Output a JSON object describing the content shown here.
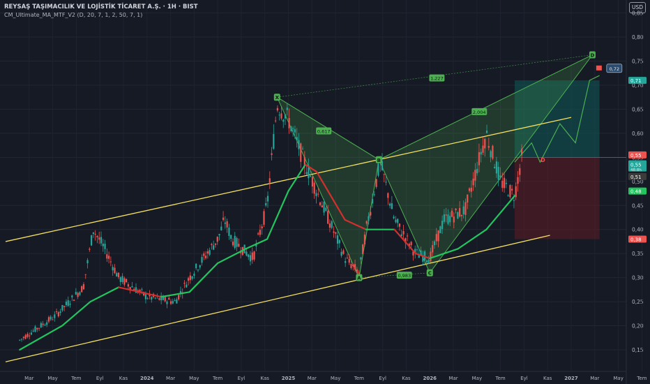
{
  "header": {
    "title": "REYSAŞ TAŞIMACILIK VE LOJİSTİK TİCARET A.Ş. · 1H · BIST",
    "indicator": "CM_Ultimate_MA_MTF_V2 (D, 20, 7, 1, 2, 50, 7, 1)"
  },
  "currency_button": "USD",
  "colors": {
    "background": "#161a25",
    "up": "#26a69a",
    "down": "#ef5350",
    "ma_up": "#22c55e",
    "ma_down": "#d32f2f",
    "channel": "#f6e05e",
    "pattern": "#4caf50",
    "target": "#26a69a",
    "stop": "#ef5350"
  },
  "chart_data": {
    "type": "candlestick",
    "ylim": [
      0.105,
      0.877
    ],
    "yticks": [
      "0,15",
      "0,20",
      "0,25",
      "0,30",
      "0,35",
      "0,40",
      "0,45",
      "0,50",
      "0,55",
      "0,60",
      "0,65",
      "0,70",
      "0,75",
      "0,80",
      "0,85"
    ],
    "xticks": [
      "Mar",
      "May",
      "Tem",
      "Eyl",
      "Kas",
      "2024",
      "Mar",
      "May",
      "Tem",
      "Eyl",
      "Kas",
      "2025",
      "Mar",
      "May",
      "Tem",
      "Eyl",
      "Kas",
      "2026",
      "Mar",
      "May",
      "Tem",
      "Eyl",
      "Kas",
      "2027",
      "Mar",
      "May",
      "Tem"
    ],
    "price_path": [
      [
        2023.1,
        0.17
      ],
      [
        2023.35,
        0.22
      ],
      [
        2023.55,
        0.28
      ],
      [
        2023.62,
        0.4
      ],
      [
        2023.7,
        0.36
      ],
      [
        2023.8,
        0.3
      ],
      [
        2024.0,
        0.26
      ],
      [
        2024.2,
        0.25
      ],
      [
        2024.3,
        0.3
      ],
      [
        2024.5,
        0.38
      ],
      [
        2024.55,
        0.42
      ],
      [
        2024.6,
        0.38
      ],
      [
        2024.75,
        0.34
      ],
      [
        2024.85,
        0.45
      ],
      [
        2024.92,
        0.66
      ],
      [
        2025.0,
        0.63
      ],
      [
        2025.1,
        0.55
      ],
      [
        2025.2,
        0.48
      ],
      [
        2025.4,
        0.34
      ],
      [
        2025.5,
        0.31
      ],
      [
        2025.55,
        0.4
      ],
      [
        2025.65,
        0.54
      ],
      [
        2025.75,
        0.42
      ],
      [
        2025.9,
        0.35
      ],
      [
        2026.0,
        0.34
      ],
      [
        2026.1,
        0.42
      ],
      [
        2026.25,
        0.44
      ],
      [
        2026.4,
        0.6
      ],
      [
        2026.5,
        0.5
      ],
      [
        2026.6,
        0.47
      ],
      [
        2026.65,
        0.55
      ]
    ],
    "ma_path": [
      [
        2023.1,
        0.15
      ],
      [
        2023.4,
        0.2
      ],
      [
        2023.6,
        0.25
      ],
      [
        2023.8,
        0.28
      ],
      [
        2024.1,
        0.26
      ],
      [
        2024.3,
        0.27
      ],
      [
        2024.5,
        0.33
      ],
      [
        2024.7,
        0.36
      ],
      [
        2024.85,
        0.38
      ],
      [
        2025.0,
        0.48
      ],
      [
        2025.12,
        0.535
      ],
      [
        2025.2,
        0.52
      ],
      [
        2025.4,
        0.42
      ],
      [
        2025.55,
        0.4
      ],
      [
        2025.75,
        0.4
      ],
      [
        2025.9,
        0.35
      ],
      [
        2026.0,
        0.34
      ],
      [
        2026.2,
        0.36
      ],
      [
        2026.4,
        0.4
      ],
      [
        2026.6,
        0.47
      ]
    ],
    "channel": {
      "upper": [
        [
          2023.0,
          0.375
        ],
        [
          2027.0,
          0.633
        ]
      ],
      "lower": [
        [
          2023.0,
          0.125
        ],
        [
          2026.85,
          0.388
        ]
      ]
    },
    "pattern": {
      "points": [
        {
          "label": "X",
          "x": 2024.92,
          "y": 0.675
        },
        {
          "label": "A",
          "x": 2025.5,
          "y": 0.3
        },
        {
          "label": "B",
          "x": 2025.64,
          "y": 0.545
        },
        {
          "label": "C",
          "x": 2026.0,
          "y": 0.31
        },
        {
          "label": "D",
          "x": 2027.15,
          "y": 0.763
        }
      ],
      "ratios": [
        {
          "label": "0,617",
          "x": 2025.25,
          "y": 0.605
        },
        {
          "label": "0,983",
          "x": 2025.82,
          "y": 0.305
        },
        {
          "label": "2,004",
          "x": 2026.35,
          "y": 0.645
        },
        {
          "label": "1,227",
          "x": 2026.05,
          "y": 0.715
        }
      ]
    },
    "position": {
      "entry": 0.55,
      "target": 0.71,
      "stop": 0.38,
      "x_start": 2026.6,
      "x_end": 2027.2
    },
    "projection": [
      [
        2026.6,
        0.54
      ],
      [
        2026.72,
        0.58
      ],
      [
        2026.78,
        0.54
      ],
      [
        2026.92,
        0.62
      ],
      [
        2027.03,
        0.58
      ],
      [
        2027.13,
        0.71
      ],
      [
        2027.2,
        0.72
      ]
    ],
    "price_labels": [
      {
        "value": "0,71",
        "price": 0.71,
        "color": "#26a69a"
      },
      {
        "value": "0,55",
        "price": 0.555,
        "color": "#ef5350"
      },
      {
        "value": "0,55",
        "price": 0.535,
        "color": "#26a69a",
        "sub": "48:8h"
      },
      {
        "value": "0,51",
        "price": 0.51,
        "color": "#3b3b3b"
      },
      {
        "value": "0,48",
        "price": 0.48,
        "color": "#22c55e"
      },
      {
        "value": "0,38",
        "price": 0.38,
        "color": "#ef5350"
      }
    ],
    "annotations": [
      {
        "label": "0,72",
        "x": 2027.3,
        "y": 0.735
      },
      {
        "label": "D",
        "x": 2026.8,
        "y": 0.545
      }
    ]
  }
}
